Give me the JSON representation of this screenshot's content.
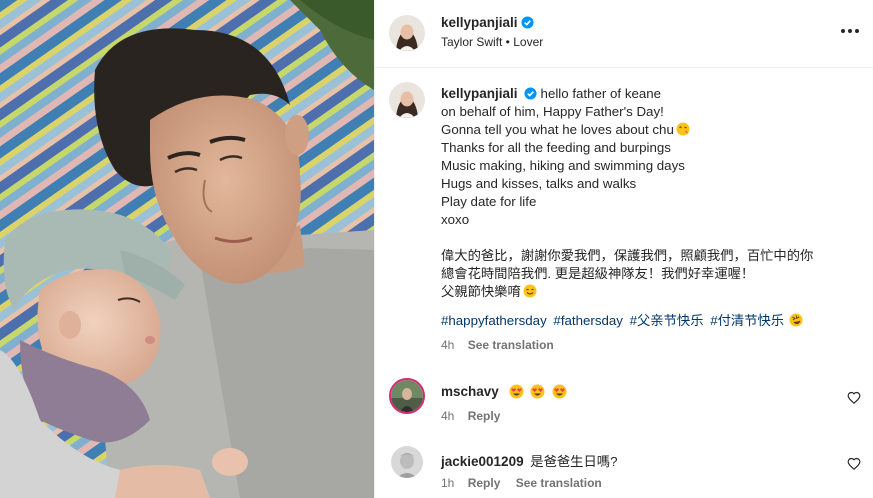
{
  "post": {
    "author": {
      "username": "kellypanjiali",
      "verified": true,
      "audio": "Taylor Swift • Lover"
    },
    "more_icon": "more-horizontal-icon",
    "caption": {
      "lines": [
        "hello father of keane",
        "on behalf of him, Happy Father's Day!",
        "Gonna tell you what he loves about chu",
        "Thanks for all the feeding and burpings",
        "Music making, hiking and swimming days",
        "Hugs and kisses, talks and walks",
        "Play date for life",
        "xoxo"
      ],
      "zh_lines": [
        "偉大的爸比，謝謝你愛我們，保護我們，照顧我們，百忙中的你",
        "總會花時間陪我們. 更是超級神隊友！我們好幸運喔！",
        "父親節快樂唷"
      ],
      "hashtags": [
        "#happyfathersday",
        "#fathersday",
        "#父亲节快乐",
        "#付清节快乐"
      ]
    },
    "meta": {
      "time": "4h",
      "translate": "See translation"
    }
  },
  "comments": [
    {
      "username": "mschavy",
      "text": "",
      "time": "4h",
      "reply": "Reply",
      "translate": ""
    },
    {
      "username": "jackie001209",
      "text": "是爸爸生日嗎?",
      "time": "1h",
      "reply": "Reply",
      "translate": "See translation"
    }
  ],
  "colors": {
    "link": "#00376b",
    "verified": "#0095f6",
    "muted": "#737373"
  }
}
